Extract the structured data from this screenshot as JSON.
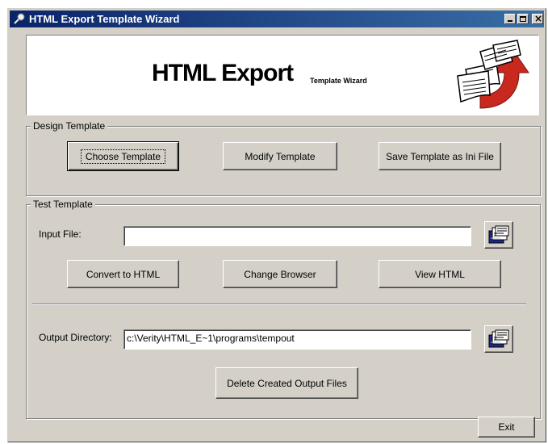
{
  "window": {
    "title": "HTML Export Template Wizard"
  },
  "banner": {
    "title": "HTML Export",
    "subtitle": "Template Wizard"
  },
  "design_template": {
    "group_label": "Design Template",
    "choose_label": "Choose Template",
    "modify_label": "Modify Template",
    "save_ini_label": "Save Template as Ini File"
  },
  "test_template": {
    "group_label": "Test Template",
    "input_file_label": "Input File:",
    "input_file_value": "",
    "convert_label": "Convert to HTML",
    "change_browser_label": "Change Browser",
    "view_html_label": "View HTML",
    "output_dir_label": "Output Directory:",
    "output_dir_value": "c:\\Verity\\HTML_E~1\\programs\\tempout",
    "delete_label": "Delete Created Output Files"
  },
  "footer": {
    "exit_label": "Exit"
  },
  "icons": {
    "browse": "file-cabinet-browse-icon",
    "logo": "documents-red-arrow-icon"
  },
  "colors": {
    "face": "#d4d0c8",
    "title_start": "#0a246a",
    "title_end": "#3a6ea5",
    "logo_arrow": "#c8281e"
  }
}
